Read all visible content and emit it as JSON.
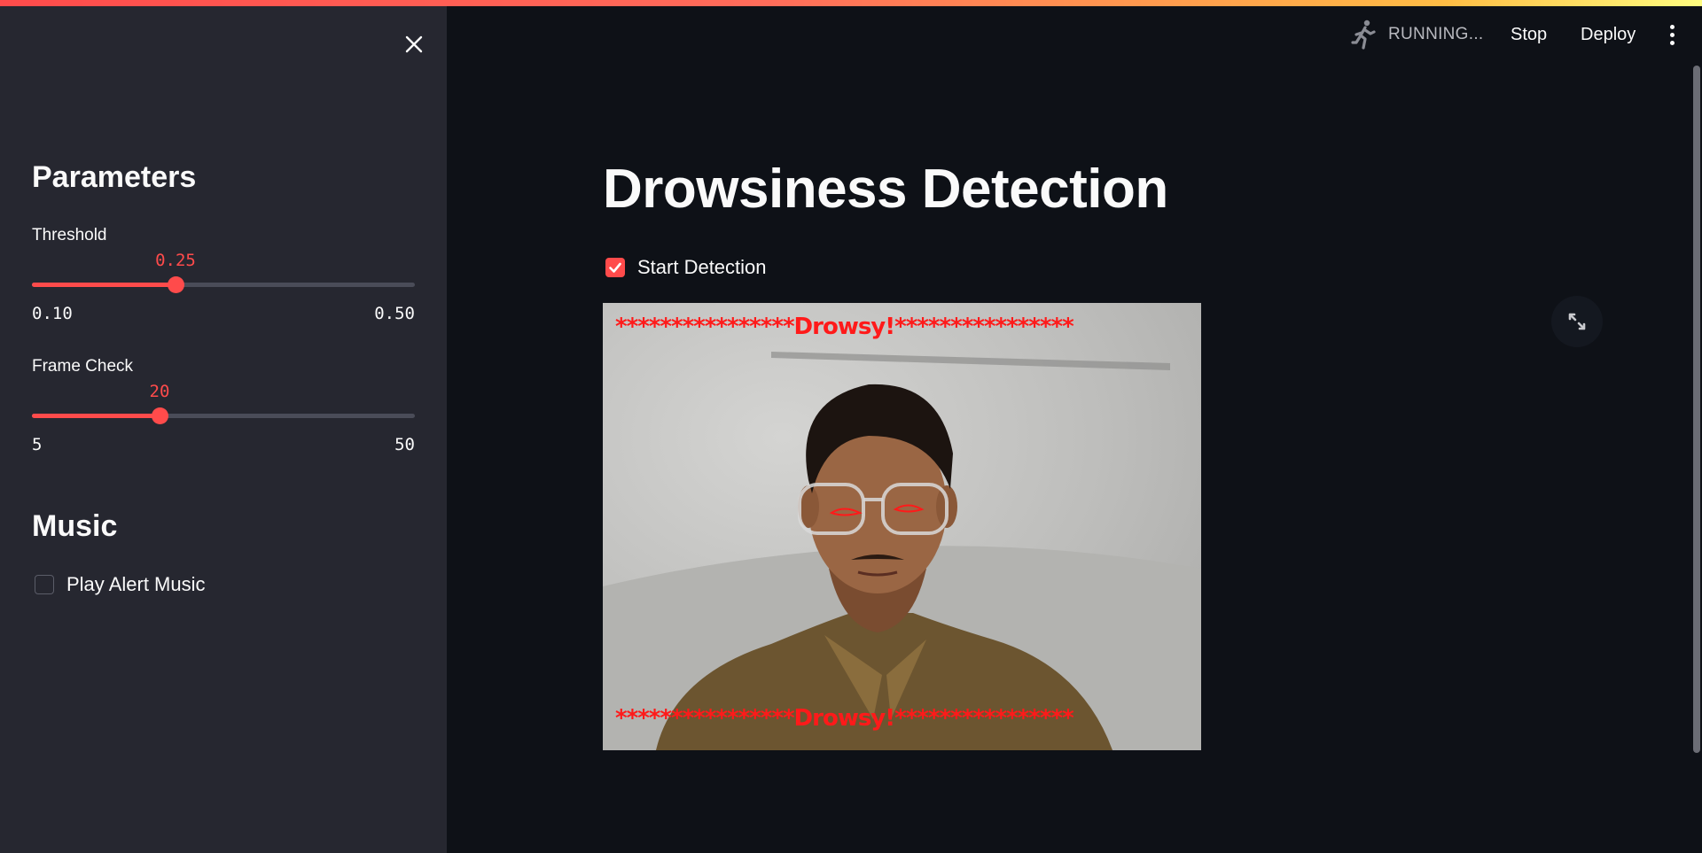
{
  "header": {
    "status": "RUNNING...",
    "stop_label": "Stop",
    "deploy_label": "Deploy",
    "status_icon": "running-man-icon",
    "menu_icon": "kebab-menu-icon"
  },
  "sidebar": {
    "close_icon": "close-icon",
    "parameters_heading": "Parameters",
    "threshold": {
      "label": "Threshold",
      "value": "0.25",
      "min": "0.10",
      "max": "0.50",
      "fraction": 0.375
    },
    "frame_check": {
      "label": "Frame Check",
      "value": "20",
      "min": "5",
      "max": "50",
      "fraction": 0.333
    },
    "music_heading": "Music",
    "play_alert_music": {
      "label": "Play Alert Music",
      "checked": false
    }
  },
  "main": {
    "title": "Drowsiness Detection",
    "start_detection": {
      "label": "Start Detection",
      "checked": true
    },
    "video": {
      "top_banner": "****************Drowsy!****************",
      "bottom_banner": "****************Drowsy!****************"
    },
    "expand_icon": "fullscreen-icon"
  },
  "colors": {
    "accent": "#ff4b4b",
    "background": "#0e1117",
    "sidebar": "#262730",
    "alert_text": "#ff1a1a"
  }
}
